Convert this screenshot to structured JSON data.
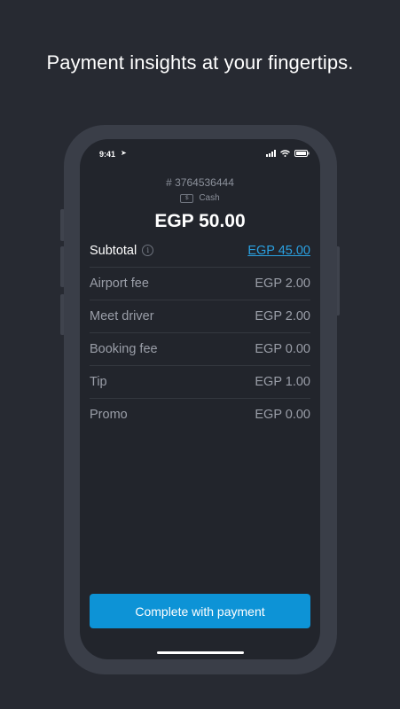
{
  "headline": "Payment insights at your fingertips.",
  "status_bar": {
    "time": "9:41",
    "location_icon": "location-arrow-icon",
    "signal_icon": "cellular-signal-icon",
    "wifi_icon": "wifi-icon",
    "battery_icon": "battery-icon"
  },
  "ride": {
    "id": "# 3764536444",
    "payment_method": "Cash",
    "cash_icon_glyph": "$",
    "total": "EGP 50.00"
  },
  "fare_rows": [
    {
      "label": "Subtotal",
      "value": "EGP 45.00"
    },
    {
      "label": "Airport fee",
      "value": "EGP 2.00"
    },
    {
      "label": "Meet driver",
      "value": "EGP 2.00"
    },
    {
      "label": "Booking fee",
      "value": "EGP 0.00"
    },
    {
      "label": "Tip",
      "value": "EGP 1.00"
    },
    {
      "label": "Promo",
      "value": "EGP 0.00"
    }
  ],
  "info_icon_glyph": "i",
  "complete_button_label": "Complete with payment",
  "colors": {
    "background": "#272a32",
    "phone_frame": "#3a3e48",
    "screen": "#22252c",
    "accent": "#0d93d6",
    "link": "#2aa0e0"
  }
}
